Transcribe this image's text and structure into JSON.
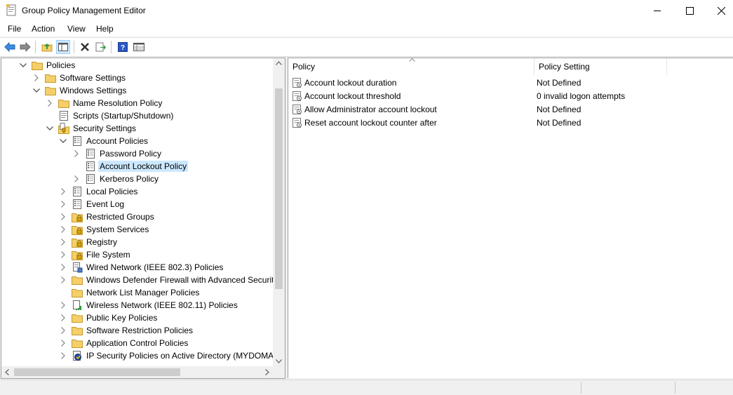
{
  "window": {
    "title": "Group Policy Management Editor"
  },
  "menu": {
    "items": [
      "File",
      "Action",
      "View",
      "Help"
    ]
  },
  "tree": [
    {
      "label": "Policies",
      "level": 0,
      "expander": "open",
      "icon": "folder-icon"
    },
    {
      "label": "Software Settings",
      "level": 1,
      "expander": "closed",
      "icon": "folder-icon"
    },
    {
      "label": "Windows Settings",
      "level": 1,
      "expander": "open",
      "icon": "folder-icon"
    },
    {
      "label": "Name Resolution Policy",
      "level": 2,
      "expander": "closed",
      "icon": "folder-icon"
    },
    {
      "label": "Scripts (Startup/Shutdown)",
      "level": 2,
      "expander": "none",
      "icon": "script-icon"
    },
    {
      "label": "Security Settings",
      "level": 2,
      "expander": "open",
      "icon": "security-folder-icon"
    },
    {
      "label": "Account Policies",
      "level": 3,
      "expander": "open",
      "icon": "policy-book-icon"
    },
    {
      "label": "Password Policy",
      "level": 4,
      "expander": "closed",
      "icon": "policy-book-icon"
    },
    {
      "label": "Account Lockout Policy",
      "level": 4,
      "expander": "none",
      "icon": "policy-book-icon",
      "selected": true
    },
    {
      "label": "Kerberos Policy",
      "level": 4,
      "expander": "closed",
      "icon": "policy-book-icon"
    },
    {
      "label": "Local Policies",
      "level": 3,
      "expander": "closed",
      "icon": "policy-book-icon"
    },
    {
      "label": "Event Log",
      "level": 3,
      "expander": "closed",
      "icon": "policy-book-icon"
    },
    {
      "label": "Restricted Groups",
      "level": 3,
      "expander": "closed",
      "icon": "lock-folder-icon"
    },
    {
      "label": "System Services",
      "level": 3,
      "expander": "closed",
      "icon": "lock-folder-icon"
    },
    {
      "label": "Registry",
      "level": 3,
      "expander": "closed",
      "icon": "lock-folder-icon"
    },
    {
      "label": "File System",
      "level": 3,
      "expander": "closed",
      "icon": "lock-folder-icon"
    },
    {
      "label": "Wired Network (IEEE 802.3) Policies",
      "level": 3,
      "expander": "closed",
      "icon": "network-icon"
    },
    {
      "label": "Windows Defender Firewall with Advanced Securit",
      "level": 3,
      "expander": "closed",
      "icon": "folder-icon"
    },
    {
      "label": "Network List Manager Policies",
      "level": 3,
      "expander": "none",
      "icon": "folder-icon"
    },
    {
      "label": "Wireless Network (IEEE 802.11) Policies",
      "level": 3,
      "expander": "closed",
      "icon": "wireless-icon"
    },
    {
      "label": "Public Key Policies",
      "level": 3,
      "expander": "closed",
      "icon": "folder-icon"
    },
    {
      "label": "Software Restriction Policies",
      "level": 3,
      "expander": "closed",
      "icon": "folder-icon"
    },
    {
      "label": "Application Control Policies",
      "level": 3,
      "expander": "closed",
      "icon": "folder-icon"
    },
    {
      "label": "IP Security Policies on Active Directory (MYDOMAI",
      "level": 3,
      "expander": "closed",
      "icon": "ipsec-icon"
    }
  ],
  "list": {
    "columns": [
      "Policy",
      "Policy Setting"
    ],
    "rows": [
      {
        "policy": "Account lockout duration",
        "setting": "Not Defined"
      },
      {
        "policy": "Account lockout threshold",
        "setting": "0 invalid logon attempts"
      },
      {
        "policy": "Allow Administrator account lockout",
        "setting": "Not Defined"
      },
      {
        "policy": "Reset account lockout counter after",
        "setting": "Not Defined"
      }
    ]
  },
  "colors": {
    "selection": "#cce8ff",
    "folder": "#f4cf6a",
    "accent": "#1e6fd9"
  }
}
